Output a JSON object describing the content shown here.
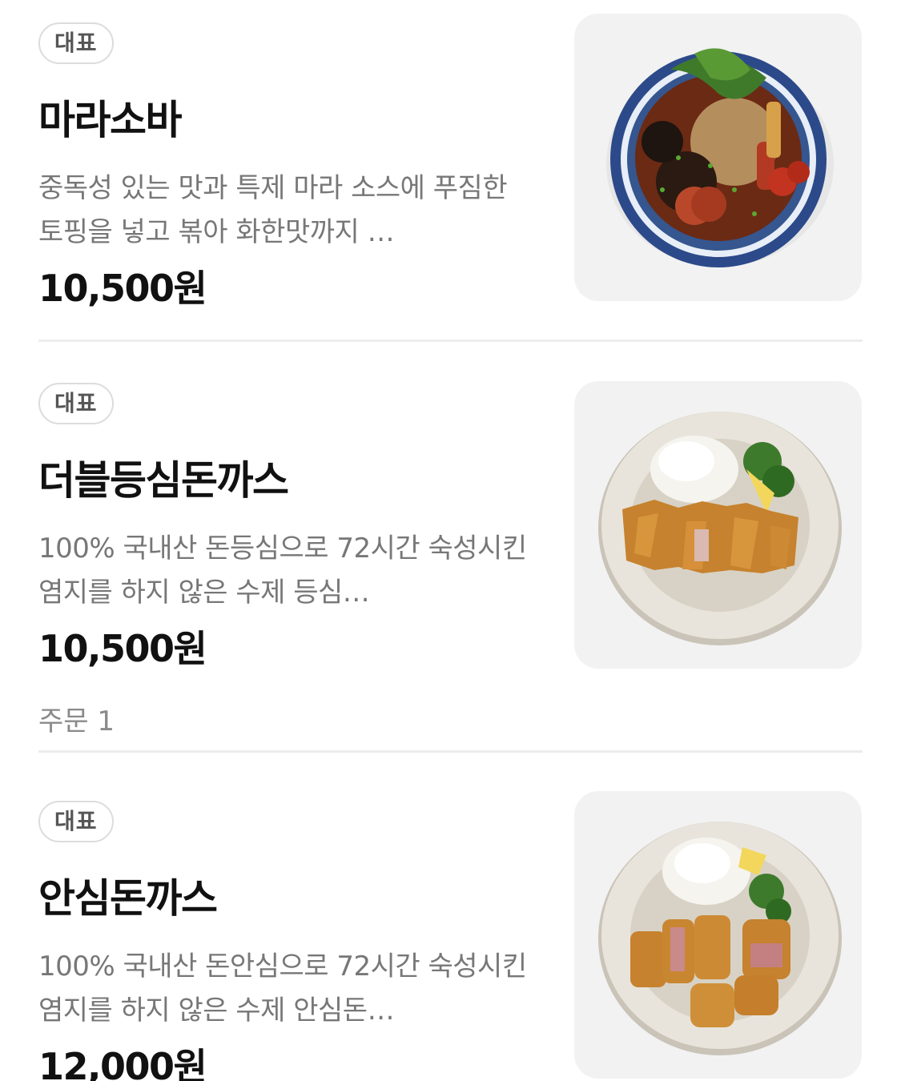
{
  "menu": {
    "items": [
      {
        "badge": "대표",
        "name": "마라소바",
        "description": "중독성 있는 맛과 특제 마라 소스에 푸짐한 토핑을 넣고 볶아 화한맛까지 …",
        "price": "10,500원",
        "image_icon": "mala-soba-bowl"
      },
      {
        "badge": "대표",
        "name": "더블등심돈까스",
        "description": "100% 국내산 돈등심으로 72시간 숙성시킨 염지를 하지 않은 수제 등심…",
        "price": "10,500원",
        "order_count": "주문 1",
        "image_icon": "double-loin-tonkatsu-plate"
      },
      {
        "badge": "대표",
        "name": "안심돈까스",
        "description": "100% 국내산 돈안심으로 72시간 숙성시킨염지를 하지 않은 수제 안심돈…",
        "price": "12,000원",
        "image_icon": "tenderloin-tonkatsu-plate"
      }
    ]
  },
  "colors": {
    "background": "#ffffff",
    "title": "#111111",
    "description": "#777777",
    "badge_border": "#dcdcdc",
    "thumbnail_bg": "#f2f2f2"
  }
}
